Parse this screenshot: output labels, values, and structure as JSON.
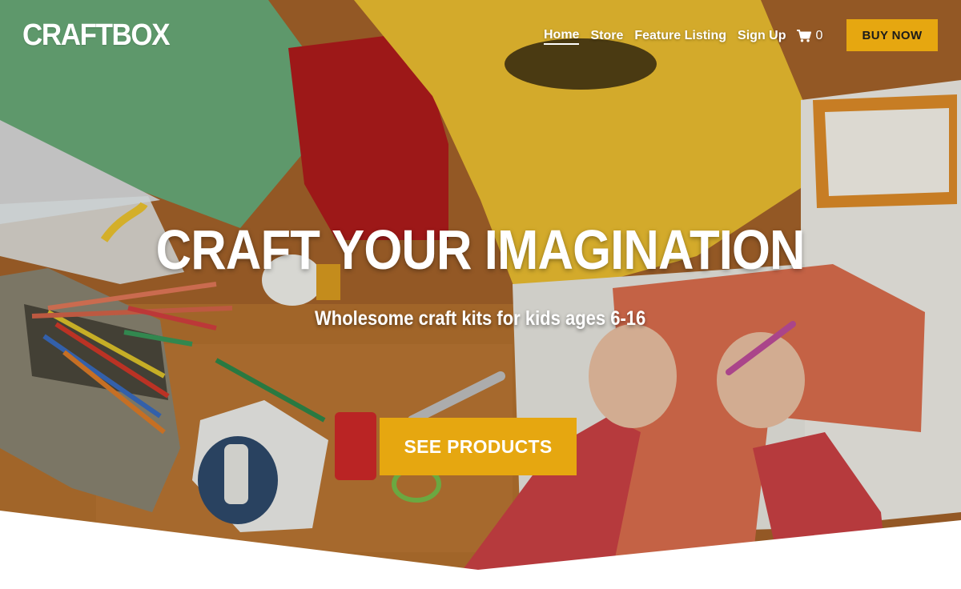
{
  "header": {
    "logo": "CRAFTBOX",
    "nav": [
      {
        "label": "Home",
        "active": true
      },
      {
        "label": "Store",
        "active": false
      },
      {
        "label": "Feature Listing",
        "active": false
      },
      {
        "label": "Sign Up",
        "active": false
      }
    ],
    "cart": {
      "icon": "shopping-cart-icon",
      "count": "0"
    },
    "buy_now_label": "BUY NOW"
  },
  "hero": {
    "title": "CRAFT YOUR IMAGINATION",
    "subtitle": "Wholesome craft kits for kids ages 6-16",
    "cta_label": "SEE PRODUCTS",
    "background": "craft-table-photo"
  },
  "colors": {
    "accent": "#e6a710",
    "text_on_hero": "#ffffff",
    "page_background": "#ffffff"
  }
}
